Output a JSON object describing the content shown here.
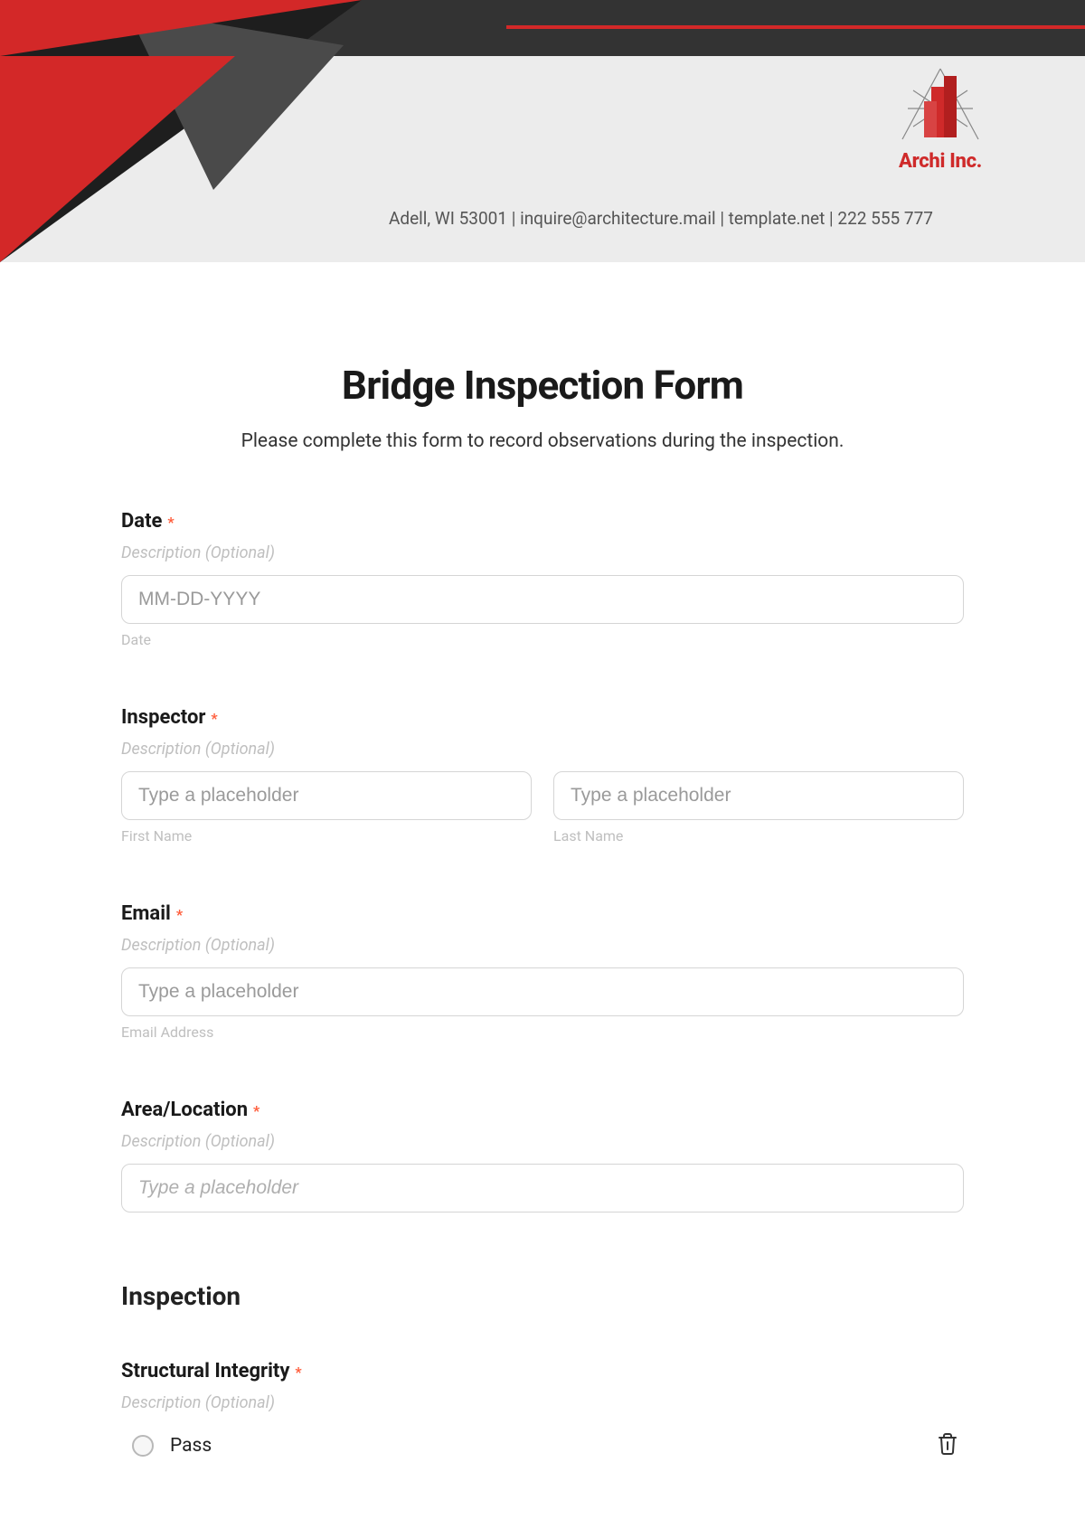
{
  "company": {
    "name": "Archi Inc.",
    "contact": "Adell, WI 53001 |   inquire@architecture.mail | template.net  | 222 555 777"
  },
  "form": {
    "title": "Bridge Inspection Form",
    "subtitle": "Please complete this form to record observations during the inspection."
  },
  "fields": {
    "date": {
      "label": "Date",
      "desc": "Description (Optional)",
      "placeholder": "MM-DD-YYYY",
      "sublabel": "Date"
    },
    "inspector": {
      "label": "Inspector",
      "desc": "Description (Optional)",
      "first_placeholder": "Type a placeholder",
      "first_sub": "First Name",
      "last_placeholder": "Type a placeholder",
      "last_sub": "Last Name"
    },
    "email": {
      "label": "Email",
      "desc": "Description (Optional)",
      "placeholder": "Type a placeholder",
      "sublabel": "Email Address"
    },
    "area": {
      "label": "Area/Location",
      "desc": "Description (Optional)",
      "placeholder": "Type a placeholder"
    }
  },
  "section": {
    "heading": "Inspection"
  },
  "structural": {
    "label": "Structural Integrity",
    "desc": "Description (Optional)",
    "options": {
      "pass": "Pass"
    }
  },
  "star": "*"
}
